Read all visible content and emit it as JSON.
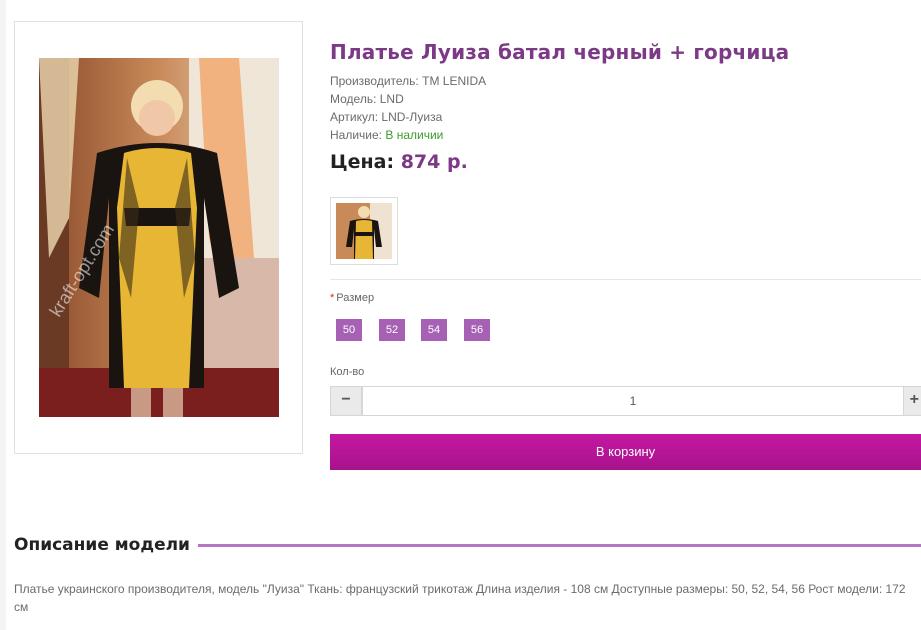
{
  "product": {
    "title": "Платье Луиза батал черный + горчица",
    "manufacturer_label": "Производитель:",
    "manufacturer_value": "TM LENIDA",
    "model_label": "Модель:",
    "model_value": "LND",
    "article_label": "Артикул:",
    "article_value": "LND-Луиза",
    "stock_label": "Наличие:",
    "stock_value": "В наличии",
    "price_label": "Цена:",
    "price_value": "874 р.",
    "watermark": "kraft-opt.com"
  },
  "options": {
    "size_label": "Размер",
    "sizes": [
      "50",
      "52",
      "54",
      "56"
    ],
    "qty_label": "Кол-во",
    "qty_value": "1",
    "minus_symbol": "−",
    "plus_symbol": "+"
  },
  "actions": {
    "cart_label": "В корзину"
  },
  "description": {
    "heading": "Описание модели",
    "text": "Платье украинского производителя, модель \"Луиза\" Ткань: французский трикотаж Длина изделия - 108 см Доступные размеры: 50, 52, 54, 56 Рост модели: 172 см"
  },
  "colors": {
    "accent": "#7c3a86",
    "size_chip": "#a661b5",
    "cart_button": "#c418a2",
    "in_stock": "#3c9a2c"
  }
}
